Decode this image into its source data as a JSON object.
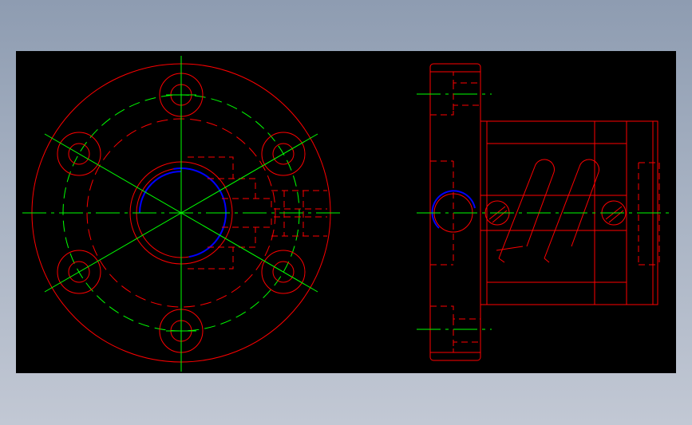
{
  "colors": {
    "background": "#000000",
    "outline": "#ff0000",
    "centerline": "#00ff00",
    "highlight": "#0000ff",
    "frame_gradient_top": "#8e9cb1",
    "frame_gradient_bottom": "#c2c8d4"
  },
  "views": [
    "front-view",
    "side-view"
  ]
}
